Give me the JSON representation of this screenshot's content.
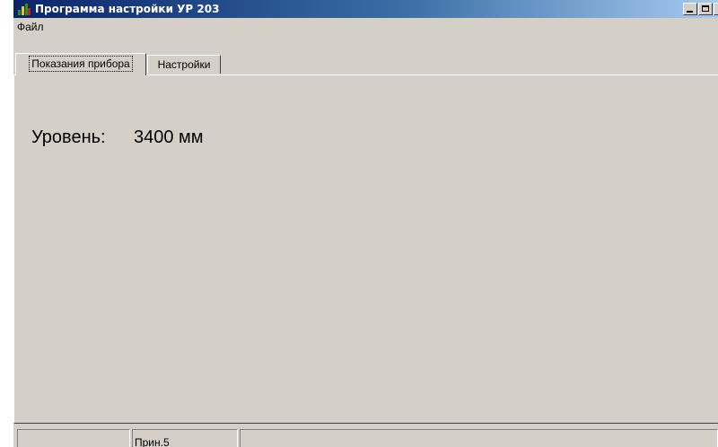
{
  "window": {
    "title": "Программа настройки УР 203",
    "controls": {
      "minimize": "_",
      "maximize": "□",
      "close": "×"
    }
  },
  "menu": {
    "items": [
      {
        "label": "Файл"
      }
    ]
  },
  "tabs": [
    {
      "label": "Показания прибора",
      "active": true
    },
    {
      "label": "Настройки",
      "active": false
    }
  ],
  "readings": {
    "level_label": "Уровень:",
    "level_value": "3400 мм"
  },
  "status": {
    "panels": [
      "",
      "Прин.5",
      ""
    ]
  },
  "colors": {
    "face": "#d4d0c8",
    "title_start": "#0a246a",
    "title_end": "#a6caf0"
  }
}
